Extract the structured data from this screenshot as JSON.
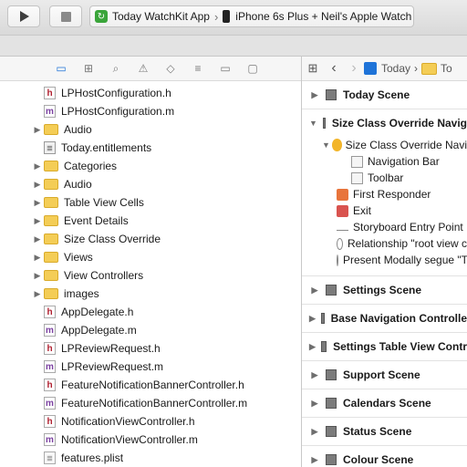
{
  "toolbar": {
    "scheme_name": "Today WatchKit App",
    "destination": "iPhone 6s Plus + Neil's Apple Watch"
  },
  "navigator": {
    "tabs": [
      "folder-icon",
      "hierarchy-icon",
      "search-icon",
      "warning-icon",
      "test-icon",
      "debug-icon",
      "breakpoint-icon",
      "report-icon"
    ],
    "files": [
      {
        "name": "LPHostConfiguration.h",
        "type": "h",
        "indent": 1
      },
      {
        "name": "LPHostConfiguration.m",
        "type": "m",
        "indent": 1
      },
      {
        "name": "Audio",
        "type": "folder",
        "indent": 0
      },
      {
        "name": "Today.entitlements",
        "type": "ent",
        "indent": 1
      },
      {
        "name": "Categories",
        "type": "folder",
        "indent": 0
      },
      {
        "name": "Audio",
        "type": "folder",
        "indent": 0
      },
      {
        "name": "Table View Cells",
        "type": "folder",
        "indent": 0
      },
      {
        "name": "Event Details",
        "type": "folder",
        "indent": 0
      },
      {
        "name": "Size Class Override",
        "type": "folder",
        "indent": 0
      },
      {
        "name": "Views",
        "type": "folder",
        "indent": 0
      },
      {
        "name": "View Controllers",
        "type": "folder",
        "indent": 0
      },
      {
        "name": "images",
        "type": "folder",
        "indent": 0
      },
      {
        "name": "AppDelegate.h",
        "type": "h",
        "indent": 1
      },
      {
        "name": "AppDelegate.m",
        "type": "m",
        "indent": 1
      },
      {
        "name": "LPReviewRequest.h",
        "type": "h",
        "indent": 1
      },
      {
        "name": "LPReviewRequest.m",
        "type": "m",
        "indent": 1
      },
      {
        "name": "FeatureNotificationBannerController.h",
        "type": "h",
        "indent": 1
      },
      {
        "name": "FeatureNotificationBannerController.m",
        "type": "m",
        "indent": 1
      },
      {
        "name": "NotificationViewController.h",
        "type": "h",
        "indent": 1
      },
      {
        "name": "NotificationViewController.m",
        "type": "m",
        "indent": 1
      },
      {
        "name": "features.plist",
        "type": "plist",
        "indent": 1
      }
    ]
  },
  "editor": {
    "breadcrumb_project": "Today",
    "breadcrumb_next": "To",
    "scenes_before": [
      {
        "name": "Today Scene"
      }
    ],
    "expanded_scene": {
      "name": "Size Class Override Navig",
      "controller": "Size Class Override Navi",
      "children": [
        {
          "name": "Navigation Bar",
          "icon": "nav-bar",
          "indent": 2
        },
        {
          "name": "Toolbar",
          "icon": "toolbar",
          "indent": 2
        },
        {
          "name": "First Responder",
          "icon": "first-responder",
          "indent": 1
        },
        {
          "name": "Exit",
          "icon": "exit",
          "indent": 1
        },
        {
          "name": "Storyboard Entry Point",
          "icon": "entry-arrow",
          "indent": 1
        },
        {
          "name": "Relationship \"root view c",
          "icon": "segue",
          "indent": 1
        },
        {
          "name": "Present Modally segue \"T",
          "icon": "segue",
          "indent": 1
        }
      ]
    },
    "scenes_after": [
      {
        "name": "Settings Scene"
      },
      {
        "name": "Base Navigation Controlle"
      },
      {
        "name": "Settings Table View Contr"
      },
      {
        "name": "Support Scene"
      },
      {
        "name": "Calendars Scene"
      },
      {
        "name": "Status Scene"
      },
      {
        "name": "Colour Scene"
      }
    ]
  }
}
